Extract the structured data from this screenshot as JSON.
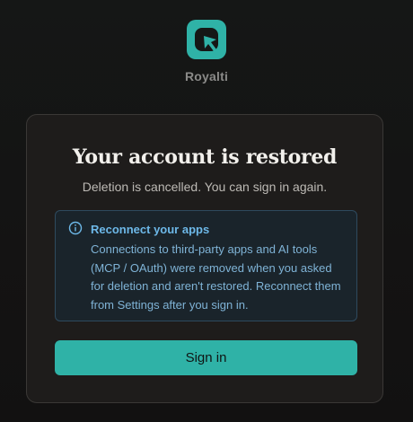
{
  "brand": {
    "name": "Royalti",
    "logo_icon": "royalti-logo-icon",
    "accent_color": "#2fb2a7"
  },
  "card": {
    "title": "Your account is restored",
    "subtitle": "Deletion is cancelled. You can sign in again."
  },
  "notice": {
    "icon": "info-icon",
    "title": "Reconnect your apps",
    "body": "Connections to third-party apps and AI tools (MCP / OAuth) were removed when you asked for deletion and aren't restored. Reconnect them from Settings after you sign in.",
    "color": "#6db8e8"
  },
  "actions": {
    "signin_label": "Sign in"
  }
}
